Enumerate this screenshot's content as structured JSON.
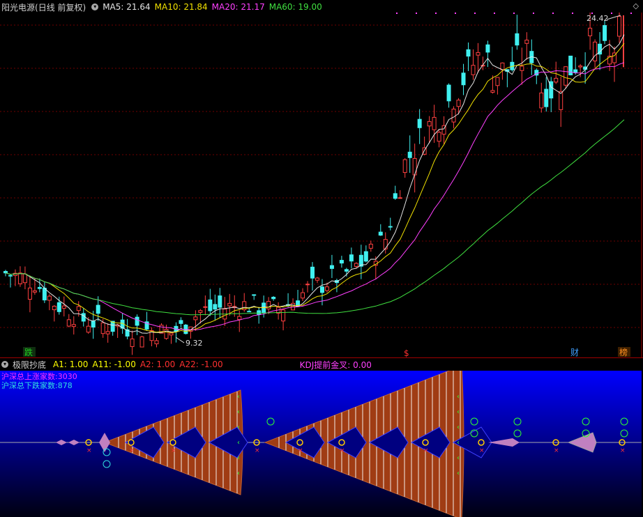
{
  "main_chart": {
    "stock_name": "阳光电源",
    "period_label": "(日线 前复权)",
    "ma5": {
      "label": "MA5: 21.64",
      "color": "#e6e6e6"
    },
    "ma10": {
      "label": "MA10: 21.84",
      "color": "#f0e000"
    },
    "ma20": {
      "label": "MA20: 21.17",
      "color": "#ff40ff"
    },
    "ma60": {
      "label": "MA60: 19.00",
      "color": "#40e040"
    },
    "high_label": "24.42",
    "low_label": "9.32",
    "event_markers": [
      {
        "text": "跌",
        "color": "#20d020",
        "bg": "#103010"
      },
      {
        "text": "$",
        "color": "#ff3030",
        "bg": "#000000"
      },
      {
        "text": "财",
        "color": "#40a0ff",
        "bg": "#000000"
      },
      {
        "text": "榜",
        "color": "#ff9020",
        "bg": "#402000"
      }
    ]
  },
  "indicator": {
    "name": "极限抄底",
    "a1": {
      "label": "A1: 1.00",
      "color": "#ffff00"
    },
    "a11": {
      "label": "A11: -1.00",
      "color": "#ffff00"
    },
    "a2": {
      "label": "A2: 1.00",
      "color": "#ff3030"
    },
    "a22": {
      "label": "A22: -1.00",
      "color": "#ff3030"
    },
    "kdj_label": "KDJ提前金叉: 0.00",
    "kdj_color": "#ff40ff",
    "rise_label": "沪深总上涨家数:3030",
    "fall_label": "沪深总下跌家数:878"
  },
  "chart_data": {
    "type": "candlestick",
    "series_names": [
      "MA5",
      "MA10",
      "MA20",
      "MA60"
    ],
    "price_high": 24.42,
    "price_low": 9.32,
    "ma_latest": {
      "MA5": 21.64,
      "MA10": 21.84,
      "MA20": 21.17,
      "MA60": 19.0
    }
  }
}
